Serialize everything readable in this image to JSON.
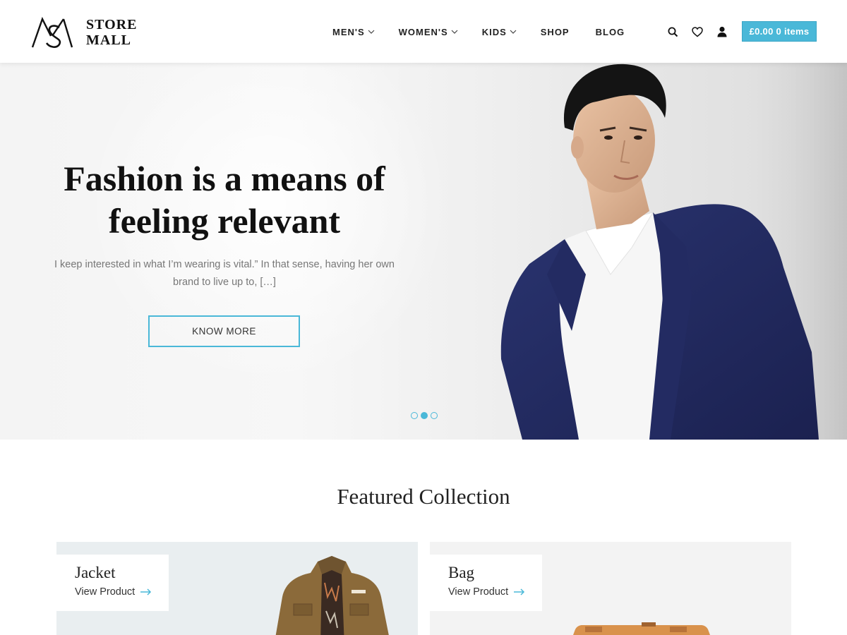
{
  "brand": {
    "line1": "STORE",
    "line2": "MALL"
  },
  "nav": {
    "items": [
      {
        "label": "MEN'S",
        "dropdown": true
      },
      {
        "label": "WOMEN'S",
        "dropdown": true
      },
      {
        "label": "KIDS",
        "dropdown": true
      },
      {
        "label": "SHOP",
        "dropdown": false
      },
      {
        "label": "BLOG",
        "dropdown": false
      }
    ]
  },
  "header_icons": [
    "search-icon",
    "heart-icon",
    "user-icon"
  ],
  "cart": {
    "label": "£0.00 0 items"
  },
  "hero": {
    "title": "Fashion is a means of feeling relevant",
    "description": "I keep interested in what I’m wearing is vital.” In that sense, having her own brand to live up to, […]",
    "button": "KNOW MORE",
    "slides": 3,
    "active_slide": 2
  },
  "featured": {
    "title": "Featured Collection",
    "cards": [
      {
        "name": "Jacket",
        "link": "View Product"
      },
      {
        "name": "Bag",
        "link": "View Product"
      }
    ]
  },
  "colors": {
    "accent": "#4ab8d8",
    "text": "#222222",
    "muted": "#777777"
  }
}
